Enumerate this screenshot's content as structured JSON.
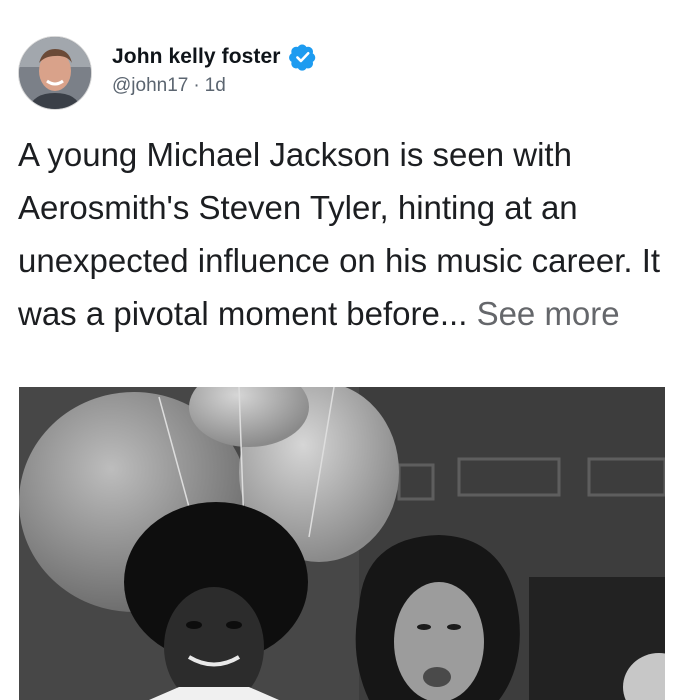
{
  "post": {
    "author": {
      "name": "John kelly foster",
      "handle": "@john17",
      "verified": true,
      "avatar_icon": "user-avatar-photo"
    },
    "timestamp": "1d",
    "separator": "·",
    "text": "A young Michael Jackson is seen with Aerosmith's Steven Tyler, hinting at an unexpected influence on his music career. It was a pivotal moment before...",
    "see_more_label": "See more",
    "media": {
      "type": "photo",
      "style": "black-and-white"
    }
  },
  "colors": {
    "verified_badge": "#1d9bf0",
    "text_primary": "#1c1e21",
    "text_secondary": "#65676b"
  }
}
